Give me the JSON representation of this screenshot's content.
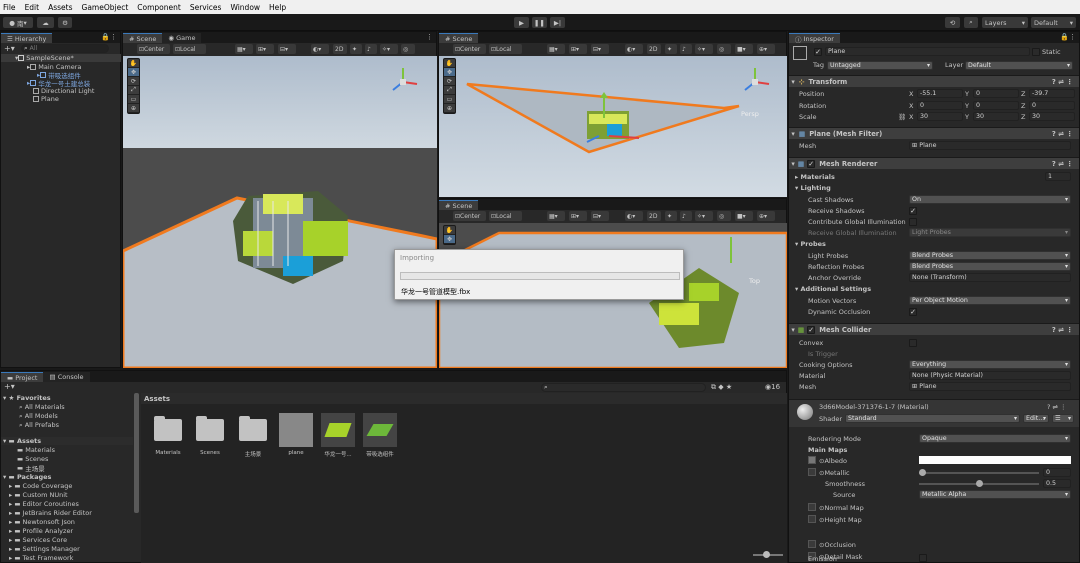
{
  "menu": [
    "File",
    "Edit",
    "Assets",
    "GameObject",
    "Component",
    "Services",
    "Window",
    "Help"
  ],
  "toolbar": {
    "account": "南",
    "layers": "Layers",
    "layout": "Default"
  },
  "hierarchy": {
    "tab": "Hierarchy",
    "search": "All",
    "items": [
      "SampleScene*",
      "Main Camera",
      "带吸选组件",
      "华龙一号土建总装",
      "Directional Light",
      "Plane"
    ]
  },
  "scene_tabs": {
    "scene": "Scene",
    "game": "Game"
  },
  "scene_toolbar": {
    "center": "Center",
    "local": "Local",
    "two_d": "2D"
  },
  "persp": "Persp",
  "top_label": "Top",
  "importing": {
    "title": "Importing",
    "file": "华龙一号管道模型.fbx",
    "progress": 0.0
  },
  "project": {
    "tabs": [
      "Project",
      "Console"
    ],
    "count": "16",
    "breadcrumb": "Assets",
    "favorites": "Favorites",
    "fav_items": [
      "All Materials",
      "All Models",
      "All Prefabs"
    ],
    "assets_root": "Assets",
    "assets_items": [
      "Materials",
      "Scenes",
      "主场景"
    ],
    "packages_root": "Packages",
    "packages": [
      "Code Coverage",
      "Custom NUnit",
      "Editor Coroutines",
      "JetBrains Rider Editor",
      "Newtonsoft Json",
      "Profile Analyzer",
      "Services Core",
      "Settings Manager",
      "Test Framework"
    ],
    "grid": [
      "Materials",
      "Scenes",
      "主场景",
      "plane",
      "华龙一号...",
      "带吸选组件"
    ]
  },
  "inspector": {
    "tab": "Inspector",
    "name": "Plane",
    "static": "Static",
    "tag_label": "Tag",
    "tag": "Untagged",
    "layer_label": "Layer",
    "layer": "Default",
    "transform": {
      "title": "Transform",
      "position": "Position",
      "rotation": "Rotation",
      "scale": "Scale",
      "pos": [
        "-55.1",
        "0",
        "-39.7"
      ],
      "rot": [
        "0",
        "0",
        "0"
      ],
      "scl": [
        "30",
        "30",
        "30"
      ],
      "axes": [
        "X",
        "Y",
        "Z"
      ]
    },
    "mesh_filter": {
      "title": "Plane (Mesh Filter)",
      "mesh_label": "Mesh",
      "mesh": "Plane"
    },
    "mesh_renderer": {
      "title": "Mesh Renderer",
      "materials": "Materials",
      "materials_count": "1",
      "lighting": "Lighting",
      "cast_shadows": "Cast Shadows",
      "cast_val": "On",
      "receive_shadows": "Receive Shadows",
      "contribute_gi": "Contribute Global Illumination",
      "receive_gi": "Receive Global Illumination",
      "receive_gi_val": "Light Probes",
      "probes": "Probes",
      "light_probes": "Light Probes",
      "light_probes_val": "Blend Probes",
      "reflection_probes": "Reflection Probes",
      "reflection_val": "Blend Probes",
      "anchor": "Anchor Override",
      "anchor_val": "None (Transform)",
      "additional": "Additional Settings",
      "motion": "Motion Vectors",
      "motion_val": "Per Object Motion",
      "dynamic_occ": "Dynamic Occlusion"
    },
    "mesh_collider": {
      "title": "Mesh Collider",
      "convex": "Convex",
      "trigger": "Is Trigger",
      "cooking": "Cooking Options",
      "cooking_val": "Everything",
      "material": "Material",
      "material_val": "None (Physic Material)",
      "mesh": "Mesh",
      "mesh_val": "Plane"
    },
    "material": {
      "title": "3d66Model-371376-1-7 (Material)",
      "shader_label": "Shader",
      "shader": "Standard",
      "edit": "Edit...",
      "rendering_mode": "Rendering Mode",
      "rendering_val": "Opaque",
      "main_maps": "Main Maps",
      "albedo": "Albedo",
      "metallic": "Metallic",
      "metallic_val": "0",
      "smoothness": "Smoothness",
      "smoothness_val": "0.5",
      "source": "Source",
      "source_val": "Metallic Alpha",
      "normal": "Normal Map",
      "height": "Height Map",
      "occlusion": "Occlusion",
      "detail": "Detail Mask",
      "emission": "Emission"
    }
  }
}
